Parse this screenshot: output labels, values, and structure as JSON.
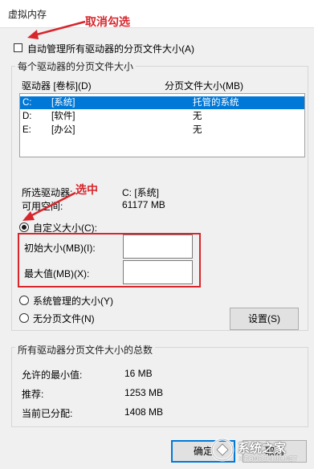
{
  "window": {
    "title": "虚拟内存"
  },
  "annotations": {
    "uncheck": "取消勾选",
    "select": "选中"
  },
  "auto_manage": {
    "label": "自动管理所有驱动器的分页文件大小(A)",
    "checked": false
  },
  "per_drive": {
    "group_label": "每个驱动器的分页文件大小",
    "col_drive": "驱动器 [卷标](D)",
    "col_size": "分页文件大小(MB)",
    "drives": [
      {
        "drive": "C:",
        "label": "[系统]",
        "size": "托管的系统",
        "selected": true
      },
      {
        "drive": "D:",
        "label": "[软件]",
        "size": "无",
        "selected": false
      },
      {
        "drive": "E:",
        "label": "[办公]",
        "size": "无",
        "selected": false
      }
    ],
    "selected_drive_label": "所选驱动器:",
    "selected_drive_value": "C:  [系统]",
    "available_label": "可用空间:",
    "available_value": "61177 MB"
  },
  "options": {
    "custom": "自定义大小(C):",
    "initial_label": "初始大小(MB)(I):",
    "initial_value": "",
    "max_label": "最大值(MB)(X):",
    "max_value": "",
    "system_managed": "系统管理的大小(Y)",
    "no_paging": "无分页文件(N)",
    "set_button": "设置(S)"
  },
  "totals": {
    "group_label": "所有驱动器分页文件大小的总数",
    "min_label": "允许的最小值:",
    "min_value": "16 MB",
    "recommended_label": "推荐:",
    "recommended_value": "1253 MB",
    "current_label": "当前已分配:",
    "current_value": "1408 MB"
  },
  "buttons": {
    "ok": "确定",
    "cancel": "取消"
  },
  "watermark": {
    "text": "系统之家",
    "url": "XITONGZHIJIA.NET"
  },
  "colors": {
    "selection": "#0078d7",
    "annotation": "#d7262c",
    "background": "#f0f0f0"
  }
}
